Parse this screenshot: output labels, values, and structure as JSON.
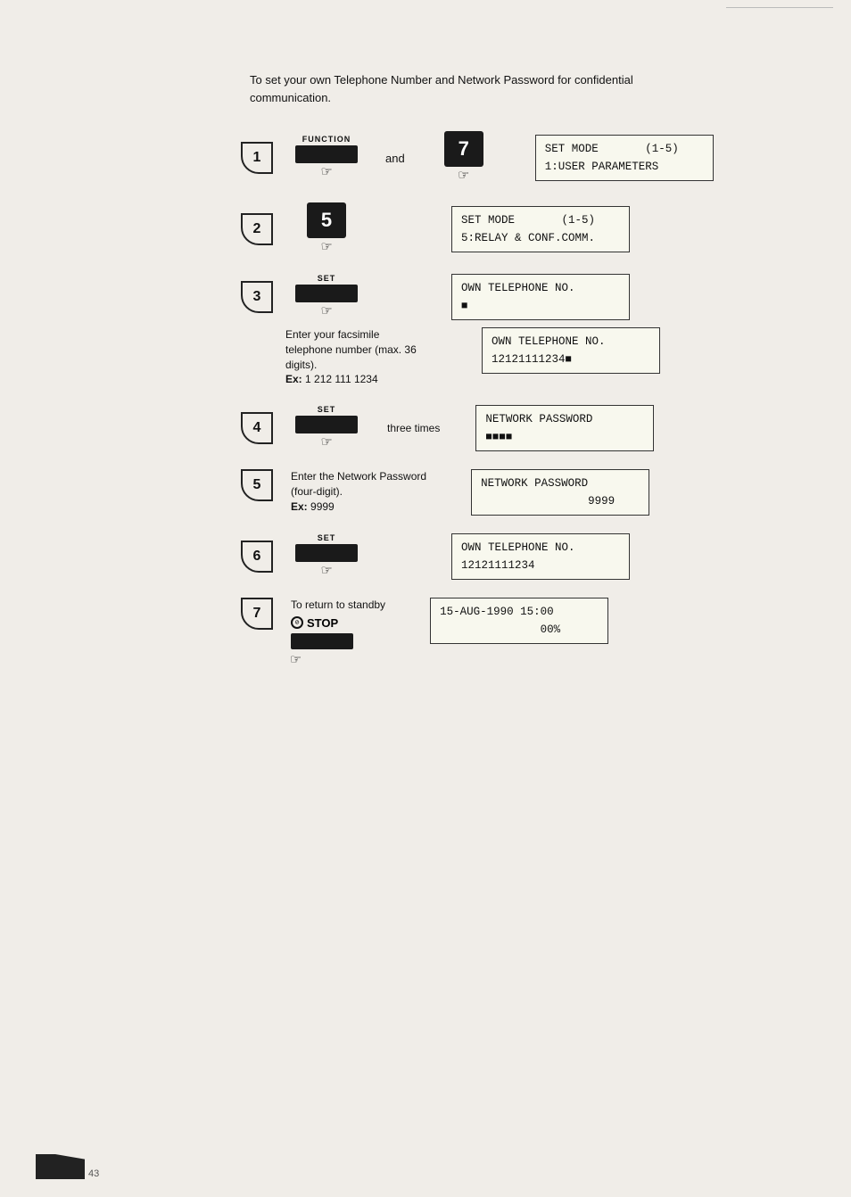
{
  "page": {
    "intro": "To set your own Telephone Number and Network Password for confidential communication.",
    "steps": [
      {
        "id": 1,
        "has_function_label": true,
        "function_label": "FUNCTION",
        "has_number_key": true,
        "number_key": "7",
        "has_and": true,
        "and_text": "and",
        "lcd_lines": [
          "SET MODE       (1-5)",
          "1:USER PARAMETERS"
        ]
      },
      {
        "id": 2,
        "number_key": "5",
        "lcd_lines": [
          "SET MODE       (1-5)",
          "5:RELAY & CONF.COMM."
        ]
      },
      {
        "id": 3,
        "button_label": "SET",
        "has_dark_btn": true,
        "description_before": null,
        "description": "Enter your facsimile telephone number (max. 36 digits).\nEx: 1 212 111 1234",
        "lcd_lines_multi": [
          [
            "OWN TELEPHONE NO.",
            "■"
          ],
          [
            "OWN TELEPHONE NO.",
            "12121111234■"
          ]
        ]
      },
      {
        "id": 4,
        "button_label": "SET",
        "has_dark_btn": true,
        "suffix_text": "three times",
        "lcd_lines": [
          "NETWORK PASSWORD",
          "■■■■"
        ]
      },
      {
        "id": 5,
        "description": "Enter the Network Password\n(four-digit).\nEx: 9999",
        "lcd_lines": [
          "NETWORK PASSWORD",
          "9999"
        ]
      },
      {
        "id": 6,
        "button_label": "SET",
        "has_dark_btn": true,
        "lcd_lines": [
          "OWN TELEPHONE NO.",
          "12121111234"
        ]
      },
      {
        "id": 7,
        "return_label": "To return to standby",
        "stop_label": "STOP",
        "has_dark_btn": true,
        "lcd_lines": [
          "15-AUG-1990 15:00",
          "                00%"
        ]
      }
    ],
    "footer_text": "43"
  }
}
